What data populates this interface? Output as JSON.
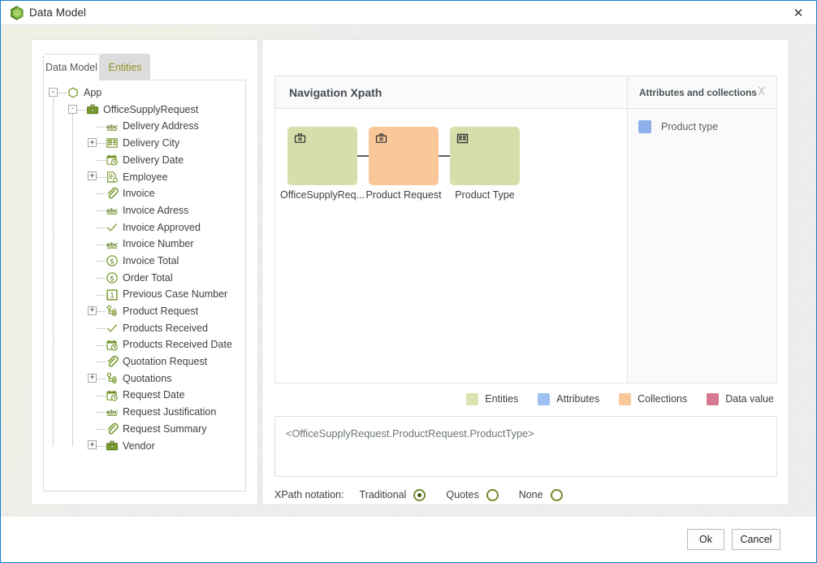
{
  "window": {
    "title": "Data Model",
    "app_icon": "hexagon-logo-icon",
    "close_label": "✕"
  },
  "left_panel": {
    "tabs": [
      {
        "label": "Data Model",
        "active": true
      },
      {
        "label": "Entities",
        "active": false
      }
    ],
    "tree": [
      {
        "label": "App",
        "depth": 0,
        "toggle": "-",
        "icon": "hexagon-icon"
      },
      {
        "label": "OfficeSupplyRequest",
        "depth": 1,
        "toggle": "-",
        "icon": "briefcase-icon"
      },
      {
        "label": "Delivery Address",
        "depth": 2,
        "toggle": "",
        "icon": "abc-icon"
      },
      {
        "label": "Delivery City",
        "depth": 2,
        "toggle": "+",
        "icon": "table-icon"
      },
      {
        "label": "Delivery Date",
        "depth": 2,
        "toggle": "",
        "icon": "calendar-clock-icon"
      },
      {
        "label": "Employee",
        "depth": 2,
        "toggle": "+",
        "icon": "document-link-icon"
      },
      {
        "label": "Invoice",
        "depth": 2,
        "toggle": "",
        "icon": "paperclip-icon"
      },
      {
        "label": "Invoice Adress",
        "depth": 2,
        "toggle": "",
        "icon": "abc-icon"
      },
      {
        "label": "Invoice Approved",
        "depth": 2,
        "toggle": "",
        "icon": "check-icon"
      },
      {
        "label": "Invoice Number",
        "depth": 2,
        "toggle": "",
        "icon": "abc-icon"
      },
      {
        "label": "Invoice Total",
        "depth": 2,
        "toggle": "",
        "icon": "currency-icon"
      },
      {
        "label": "Order Total",
        "depth": 2,
        "toggle": "",
        "icon": "currency-icon"
      },
      {
        "label": "Previous Case Number",
        "depth": 2,
        "toggle": "",
        "icon": "number-one-icon"
      },
      {
        "label": "Product Request",
        "depth": 2,
        "toggle": "+",
        "icon": "collection-icon"
      },
      {
        "label": "Products Received",
        "depth": 2,
        "toggle": "",
        "icon": "check-icon"
      },
      {
        "label": "Products Received Date",
        "depth": 2,
        "toggle": "",
        "icon": "calendar-clock-icon"
      },
      {
        "label": "Quotation Request",
        "depth": 2,
        "toggle": "",
        "icon": "paperclip-icon"
      },
      {
        "label": "Quotations",
        "depth": 2,
        "toggle": "+",
        "icon": "collection-icon"
      },
      {
        "label": "Request Date",
        "depth": 2,
        "toggle": "",
        "icon": "calendar-clock-icon"
      },
      {
        "label": "Request Justification",
        "depth": 2,
        "toggle": "",
        "icon": "abc-icon"
      },
      {
        "label": "Request Summary",
        "depth": 2,
        "toggle": "",
        "icon": "paperclip-icon"
      },
      {
        "label": "Vendor",
        "depth": 2,
        "toggle": "+",
        "icon": "briefcase-icon"
      }
    ]
  },
  "right_panel": {
    "nav_title": "Navigation Xpath",
    "attributes_title": "Attributes and collections",
    "attributes_close": "X",
    "attribute_items": [
      {
        "label": "Product type",
        "color": "#8cb0ec"
      }
    ],
    "diagram": {
      "nodes": [
        {
          "label": "OfficeSupplyReq...",
          "icon": "briefcase-icon",
          "color": "#d4dfab",
          "type": "entity"
        },
        {
          "label": "Product Request",
          "icon": "briefcase-icon",
          "color": "#f9c79a",
          "type": "collection"
        },
        {
          "label": "Product Type",
          "icon": "table-icon",
          "color": "#d4dfab",
          "type": "entity"
        }
      ]
    },
    "legend": [
      {
        "label": "Entities",
        "color": "#d9e3b0"
      },
      {
        "label": "Attributes",
        "color": "#9cc0f2"
      },
      {
        "label": "Collections",
        "color": "#f9c79a"
      },
      {
        "label": "Data value",
        "color": "#d4798f"
      }
    ],
    "xpath_value": "<OfficeSupplyRequest.ProductRequest.ProductType>",
    "notation": {
      "label": "XPath notation:",
      "options": [
        {
          "label": "Traditional",
          "checked": true
        },
        {
          "label": "Quotes",
          "checked": false
        },
        {
          "label": "None",
          "checked": false
        }
      ]
    }
  },
  "footer": {
    "ok_label": "Ok",
    "cancel_label": "Cancel"
  }
}
